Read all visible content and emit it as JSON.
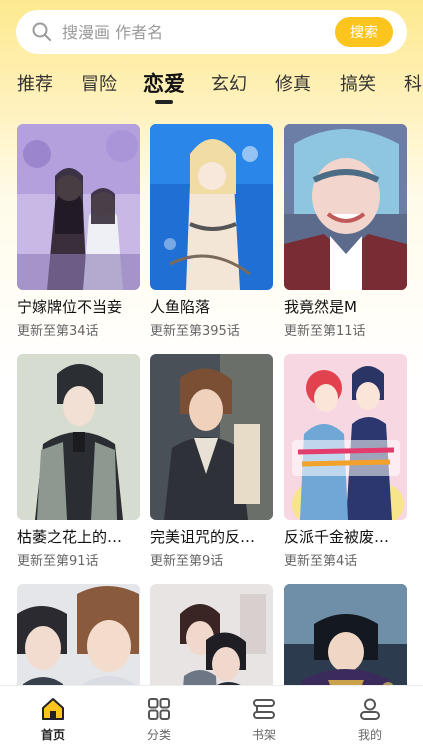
{
  "search": {
    "placeholder": "搜漫画 作者名",
    "button_label": "搜索"
  },
  "tabs": [
    {
      "label": "推荐"
    },
    {
      "label": "冒险"
    },
    {
      "label": "恋爱",
      "active": true
    },
    {
      "label": "玄幻"
    },
    {
      "label": "修真"
    },
    {
      "label": "搞笑"
    },
    {
      "label": "科"
    }
  ],
  "comics": [
    {
      "title": "宁嫁牌位不当妾",
      "update": "更新至第34话"
    },
    {
      "title": "人鱼陷落",
      "update": "更新至第395话"
    },
    {
      "title": "我竟然是M",
      "update": "更新至第11话"
    },
    {
      "title": "枯萎之花上的…",
      "update": "更新至第91话"
    },
    {
      "title": "完美诅咒的反…",
      "update": "更新至第9话"
    },
    {
      "title": "反派千金被废…",
      "update": "更新至第4话"
    },
    {
      "title": "",
      "update": ""
    },
    {
      "title": "",
      "update": ""
    },
    {
      "title": "",
      "update": ""
    }
  ],
  "bottom_nav": [
    {
      "label": "首页",
      "icon": "home-icon",
      "active": true
    },
    {
      "label": "分类",
      "icon": "grid-icon"
    },
    {
      "label": "书架",
      "icon": "bookshelf-icon"
    },
    {
      "label": "我的",
      "icon": "profile-icon"
    }
  ],
  "colors": {
    "accent": "#fcc51e",
    "header_gradient_top": "#fde98f"
  }
}
